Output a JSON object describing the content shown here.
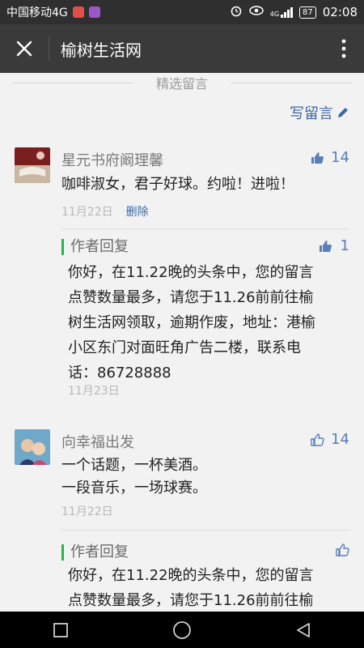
{
  "status": {
    "carrier": "中国移动4G",
    "battery": "87",
    "time": "02:08",
    "network": "4G"
  },
  "app": {
    "title": "榆树生活网"
  },
  "section": {
    "title": "精选留言",
    "write": "写留言"
  },
  "comments": [
    {
      "name": "星元书府阚理馨",
      "likes": "14",
      "text": "咖啡淑女，君子好球。约啦！进啦！",
      "date": "11月22日",
      "delete": "删除",
      "reply": {
        "label": "作者回复",
        "likes": "1",
        "lines": [
          "你好，在11.22晚的头条中，您的留言",
          "点赞数量最多，请您于11.26前前往榆",
          "树生活网领取，逾期作废，地址：港榆",
          "小区东门对面旺角广告二楼，联系电",
          "话：86728888"
        ],
        "date": "11月23日"
      }
    },
    {
      "name": "向幸福出发",
      "likes": "14",
      "lines": [
        "一个话题，一杯美酒。",
        "一段音乐，一场球赛。"
      ],
      "date": "11月22日",
      "reply": {
        "label": "作者回复",
        "lines": [
          "你好，在11.22晚的头条中，您的留言",
          "点赞数量最多，请您于11.26前前往榆"
        ]
      }
    }
  ],
  "colors": {
    "link": "#3e68a8",
    "accent": "#2ab44a",
    "appbar": "#3a3a3a"
  }
}
